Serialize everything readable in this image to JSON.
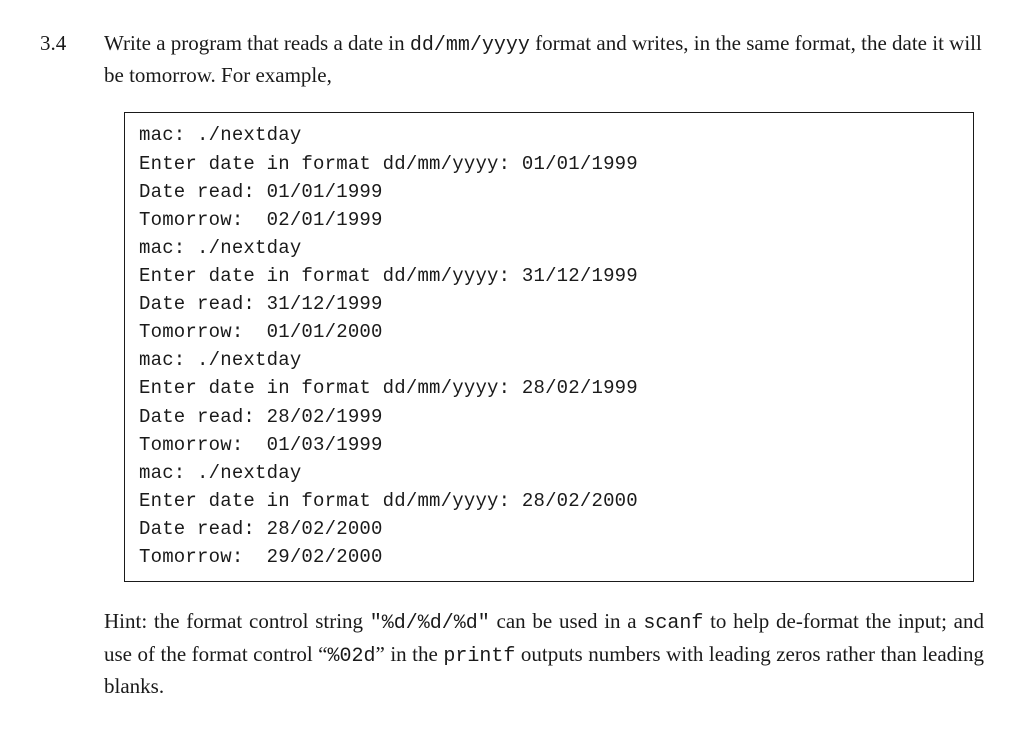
{
  "exercise": {
    "number": "3.4",
    "text_before_mono1": "Write a program that reads a date in ",
    "mono1": "dd/mm/yyyy",
    "text_after_mono1": " format and writes, in the same format, the date it will be tomorrow. For example,"
  },
  "code_lines": [
    "mac: ./nextday",
    "Enter date in format dd/mm/yyyy: 01/01/1999",
    "Date read: 01/01/1999",
    "Tomorrow:  02/01/1999",
    "mac: ./nextday",
    "Enter date in format dd/mm/yyyy: 31/12/1999",
    "Date read: 31/12/1999",
    "Tomorrow:  01/01/2000",
    "mac: ./nextday",
    "Enter date in format dd/mm/yyyy: 28/02/1999",
    "Date read: 28/02/1999",
    "Tomorrow:  01/03/1999",
    "mac: ./nextday",
    "Enter date in format dd/mm/yyyy: 28/02/2000",
    "Date read: 28/02/2000",
    "Tomorrow:  29/02/2000"
  ],
  "hint": {
    "t1": "Hint: the format control string ",
    "m1": "\"%d/%d/%d\"",
    "t2": " can be used in a ",
    "m2": "scanf",
    "t3": " to help de-format the input; and use of the format control “",
    "m3": "%02d",
    "t4": "” in the ",
    "m4": "printf",
    "t5": " outputs numbers with leading zeros rather than leading blanks."
  }
}
